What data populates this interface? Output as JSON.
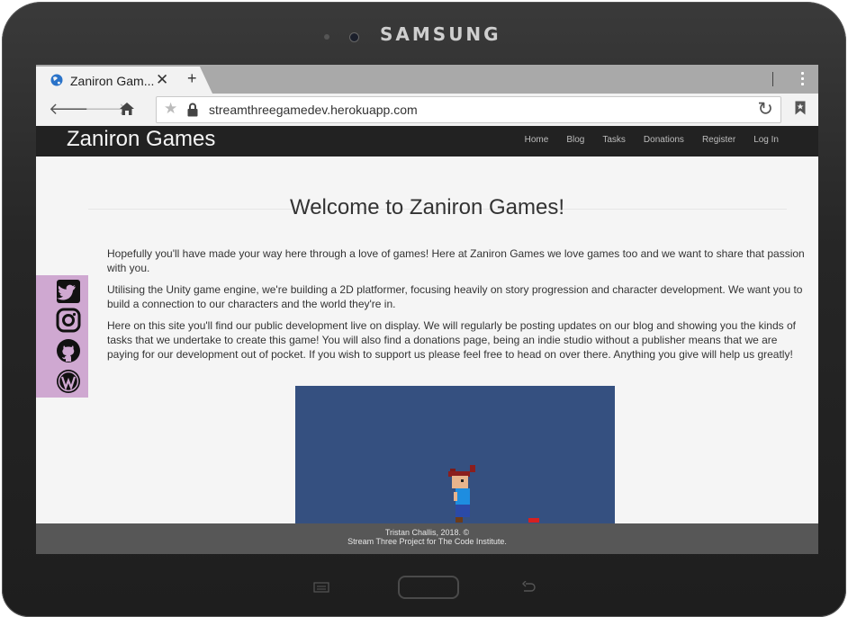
{
  "device": {
    "brand": "SAMSUNG"
  },
  "browser": {
    "tab_title": "Zaniron Gam...",
    "tab_close": "✕",
    "new_tab": "+",
    "url": "streamthreegamedev.herokuapp.com"
  },
  "site": {
    "brand": "Zaniron Games",
    "nav": [
      "Home",
      "Blog",
      "Tasks",
      "Donations",
      "Register",
      "Log In"
    ],
    "heading": "Welcome to Zaniron Games!",
    "paragraphs": [
      "Hopefully you'll have made your way here through a love of games! Here at Zaniron Games we love games too and we want to share that passion with you.",
      "Utilising the Unity game engine, we're building a 2D platformer, focusing heavily on story progression and character development. We want you to build a connection to our characters and the world they're in.",
      "Here on this site you'll find our public development live on display. We will regularly be posting updates on our blog and showing you the kinds of tasks that we undertake to create this game! You will also find a donations page, being an indie studio without a publisher means that we are paying for our development out of pocket. If you wish to support us please feel free to head on over there. Anything you give will help us greatly!"
    ],
    "social_icons": [
      "twitter-icon",
      "instagram-icon",
      "github-icon",
      "wordpress-icon"
    ],
    "footer_line1": "Tristan Challis, 2018. ©",
    "footer_line2": "Stream Three Project for The Code Institute."
  },
  "colors": {
    "navbar": "#222222",
    "social_panel": "#cfa8d1",
    "game_background": "#355080",
    "footer": "#575757"
  }
}
